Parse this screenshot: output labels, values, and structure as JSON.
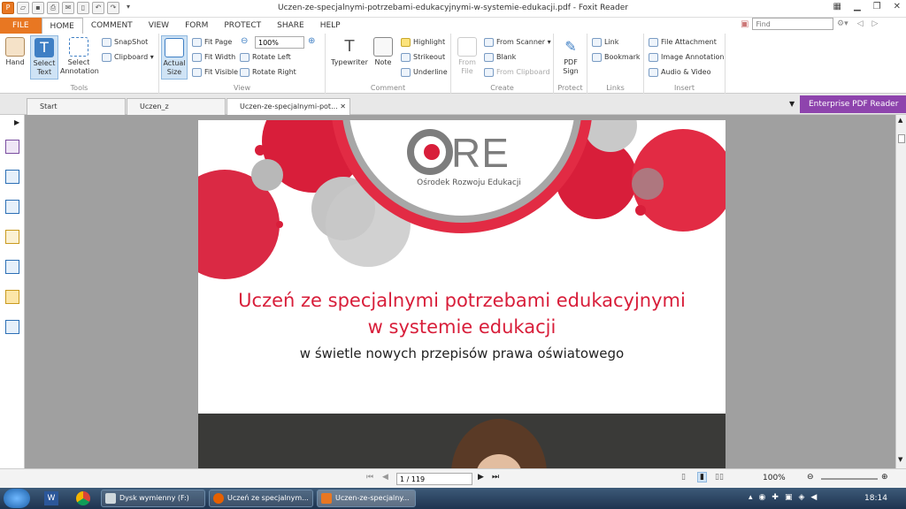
{
  "window": {
    "title": "Uczen-ze-specjalnymi-potrzebami-edukacyjnymi-w-systemie-edukacji.pdf - Foxit Reader"
  },
  "menu_tabs": [
    {
      "label": "FILE"
    },
    {
      "label": "HOME"
    },
    {
      "label": "COMMENT"
    },
    {
      "label": "VIEW"
    },
    {
      "label": "FORM"
    },
    {
      "label": "PROTECT"
    },
    {
      "label": "SHARE"
    },
    {
      "label": "HELP"
    }
  ],
  "find": {
    "placeholder": "Find"
  },
  "ribbon": {
    "tools": {
      "label": "Tools",
      "hand": "Hand",
      "select_text": "Select Text",
      "select_annotation": "Select Annotation",
      "snapshot": "SnapShot",
      "clipboard": "Clipboard"
    },
    "view": {
      "label": "View",
      "actual_size": "Actual Size",
      "fit_page": "Fit Page",
      "fit_width": "Fit Width",
      "fit_visible": "Fit Visible",
      "zoom": "100%",
      "rotate_left": "Rotate Left",
      "rotate_right": "Rotate Right"
    },
    "comment": {
      "label": "Comment",
      "typewriter": "Typewriter",
      "note": "Note",
      "highlight": "Highlight",
      "strikeout": "Strikeout",
      "underline": "Underline"
    },
    "create": {
      "label": "Create",
      "from_file": "From File",
      "from_scanner": "From Scanner",
      "blank": "Blank",
      "from_clipboard": "From Clipboard"
    },
    "protect": {
      "label": "Protect",
      "pdf_sign": "PDF Sign"
    },
    "links": {
      "label": "Links",
      "link": "Link",
      "bookmark": "Bookmark"
    },
    "insert": {
      "label": "Insert",
      "file_attachment": "File Attachment",
      "image_annotation": "Image Annotation",
      "audio_video": "Audio & Video"
    }
  },
  "doc_tabs": [
    {
      "label": "Start"
    },
    {
      "label": "Uczen_z zespolem_Asp..."
    },
    {
      "label": "Uczen-ze-specjalnymi-pot..."
    }
  ],
  "enterprise": "Enterprise PDF Reader",
  "document": {
    "logo_text": "RE",
    "org_name": "Ośrodek Rozwoju Edukacji",
    "title_line1": "Uczeń ze specjalnymi potrzebami edukacyjnymi",
    "title_line2": "w systemie edukacji",
    "subtitle": "w świetle nowych przepisów prawa oświatowego"
  },
  "status": {
    "page": "1 / 119",
    "zoom": "100%"
  },
  "taskbar": {
    "items": [
      {
        "label": "Dysk wymienny (F:)"
      },
      {
        "label": "Uczeń ze specjalnym..."
      },
      {
        "label": "Uczen-ze-specjalny..."
      }
    ],
    "clock": "18:14"
  },
  "colors": {
    "accent_red": "#d81e3a",
    "file_tab": "#e87722",
    "enterprise": "#8e44ad"
  }
}
